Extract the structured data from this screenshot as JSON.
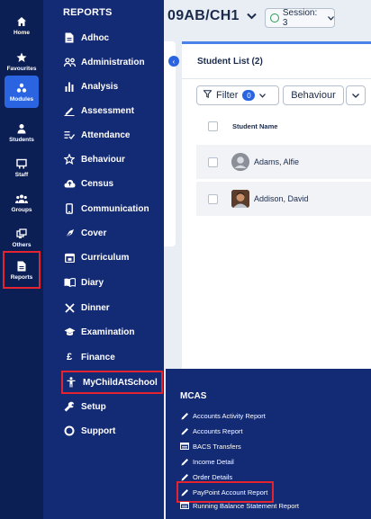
{
  "rail": {
    "items": [
      {
        "label": "Home",
        "icon": "home-icon"
      },
      {
        "label": "Favourites",
        "icon": "star-icon"
      },
      {
        "label": "Modules",
        "icon": "modules-icon"
      },
      {
        "label": "Students",
        "icon": "students-icon"
      },
      {
        "label": "Staff",
        "icon": "staff-icon"
      },
      {
        "label": "Groups",
        "icon": "groups-icon"
      },
      {
        "label": "Others",
        "icon": "others-icon"
      },
      {
        "label": "Reports",
        "icon": "reports-icon"
      }
    ],
    "active": "Modules",
    "highlighted": "Reports"
  },
  "reports": {
    "title": "REPORTS",
    "items": [
      {
        "label": "Adhoc",
        "icon": "document-icon"
      },
      {
        "label": "Administration",
        "icon": "people-icon"
      },
      {
        "label": "Analysis",
        "icon": "bar-chart-icon"
      },
      {
        "label": "Assessment",
        "icon": "pencil-line-icon"
      },
      {
        "label": "Attendance",
        "icon": "checklist-icon"
      },
      {
        "label": "Behaviour",
        "icon": "star-outline-icon"
      },
      {
        "label": "Census",
        "icon": "cloud-icon"
      },
      {
        "label": "Communication",
        "icon": "phone-icon"
      },
      {
        "label": "Cover",
        "icon": "cover-icon"
      },
      {
        "label": "Curriculum",
        "icon": "calendar-icon"
      },
      {
        "label": "Diary",
        "icon": "book-icon"
      },
      {
        "label": "Dinner",
        "icon": "cutlery-icon"
      },
      {
        "label": "Examination",
        "icon": "graduation-cap-icon"
      },
      {
        "label": "Finance",
        "icon": "pound-icon"
      },
      {
        "label": "MyChildAtSchool",
        "icon": "child-icon"
      },
      {
        "label": "Setup",
        "icon": "wrench-icon"
      },
      {
        "label": "Support",
        "icon": "support-icon"
      }
    ],
    "highlighted": "MyChildAtSchool"
  },
  "main": {
    "class_title": "09AB/CH1",
    "session_label": "Session: 3",
    "list_title": "Student List (2)",
    "filter_label": "Filter",
    "filter_count": "0",
    "behaviour_label": "Behaviour",
    "column_header": "Student Name",
    "students": [
      {
        "name": "Adams, Alfie"
      },
      {
        "name": "Addison, David"
      }
    ]
  },
  "mcas": {
    "title": "MCAS",
    "items": [
      {
        "label": "Accounts Activity Report",
        "icon": "pencil-icon"
      },
      {
        "label": "Accounts Report",
        "icon": "pencil-icon"
      },
      {
        "label": "BACS Transfers",
        "icon": "table-icon"
      },
      {
        "label": "Income Detail",
        "icon": "pencil-icon"
      },
      {
        "label": "Order Details",
        "icon": "pencil-icon"
      },
      {
        "label": "PayPoint Account Report",
        "icon": "pencil-icon"
      },
      {
        "label": "Running Balance Statement Report",
        "icon": "table-icon"
      }
    ],
    "highlighted": "PayPoint Account Report"
  },
  "colors": {
    "rail_bg": "#0c1f55",
    "panel_bg": "#132a75",
    "accent": "#2a64e0",
    "highlight": "#e3232f"
  }
}
